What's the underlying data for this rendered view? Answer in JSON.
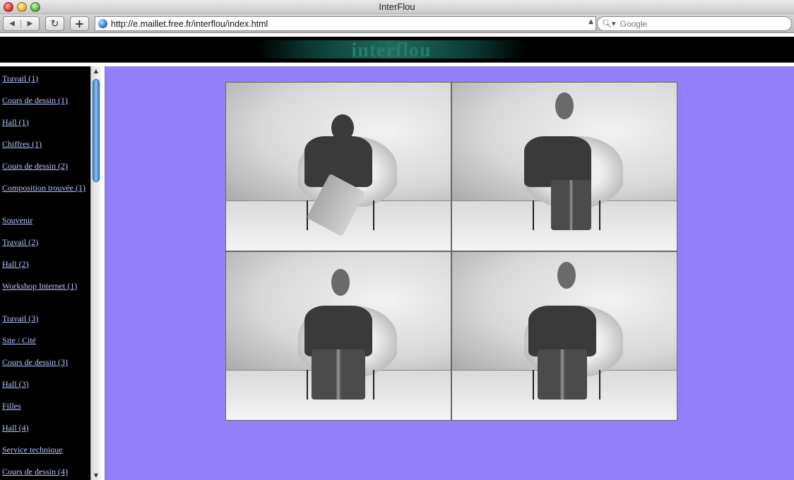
{
  "window": {
    "title": "InterFlou"
  },
  "toolbar": {
    "url": "http://e.maillet.free.fr/interflou/index.html",
    "search_placeholder": "Google"
  },
  "banner": {
    "logo_text": "interflou"
  },
  "sidebar": {
    "items": [
      {
        "label": "Travail (1)"
      },
      {
        "label": "Cours de dessin (1)"
      },
      {
        "label": "Hall (1)"
      },
      {
        "label": "Chiffres (1)"
      },
      {
        "label": "Cours de dessin (2)"
      },
      {
        "label": "Composition trouvée (1)"
      },
      {
        "label": "Souvenir"
      },
      {
        "label": "Travail (2)"
      },
      {
        "label": "Hall (2)"
      },
      {
        "label": "Workshop Internet (1)"
      },
      {
        "label": "Travail (3)"
      },
      {
        "label": "Site / Cité"
      },
      {
        "label": "Cours de dessin (3)"
      },
      {
        "label": "Hall (3)"
      },
      {
        "label": "Filles"
      },
      {
        "label": "Hall (4)"
      },
      {
        "label": "Service technique"
      },
      {
        "label": "Cours de dessin (4)"
      }
    ]
  },
  "colors": {
    "content_background": "#937ff9",
    "sidebar_background": "#000000",
    "link_color": "#b9c4ff"
  }
}
